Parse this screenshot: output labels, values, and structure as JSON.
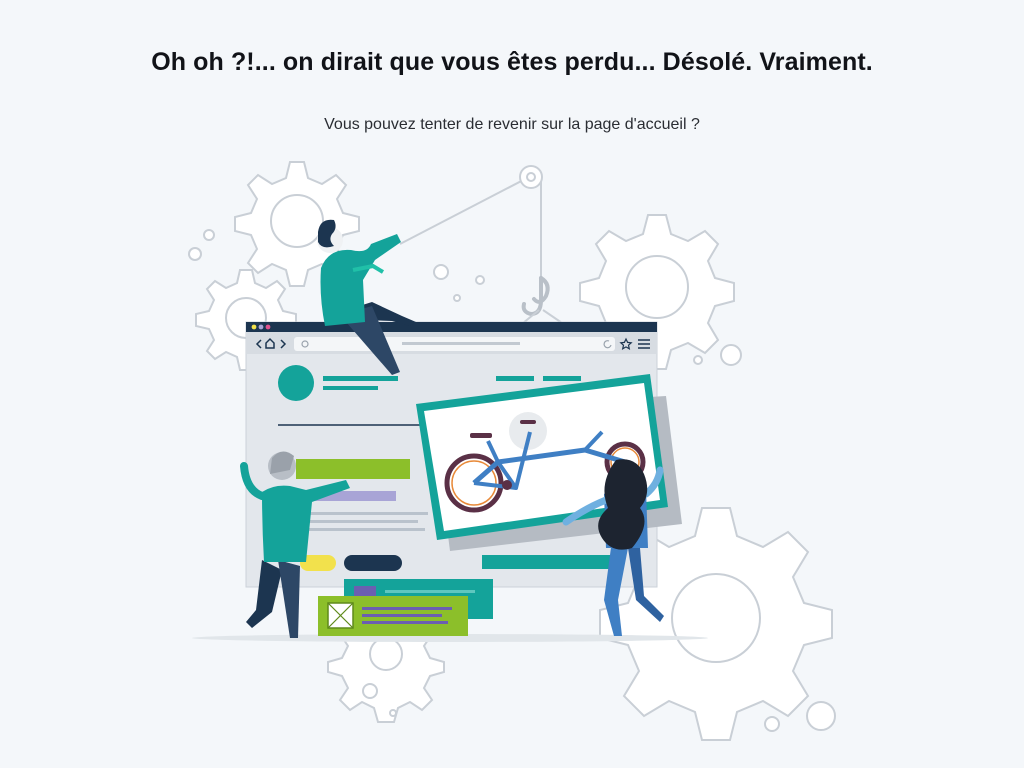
{
  "error_page": {
    "headline": "Oh oh ?!... on dirait que vous êtes perdu... Désolé. Vraiment.",
    "subline_before": "Vous pouvez tenter de revenir sur la ",
    "home_link": "page d'accueil",
    "subline_after": " ?"
  },
  "colors": {
    "teal": "#14a39a",
    "navy": "#1c3550",
    "lime": "#8cbf2a",
    "lavender": "#a8a4d6",
    "yellow": "#f2e14c",
    "gear": "#c9cfd6",
    "bike_blue": "#3f7fc4"
  },
  "illustration": {
    "icons": [
      "gear-icon",
      "pulley-icon",
      "crane-hook-icon",
      "bike-icon",
      "star-icon",
      "menu-icon",
      "home-icon",
      "search-icon",
      "reload-icon"
    ]
  }
}
